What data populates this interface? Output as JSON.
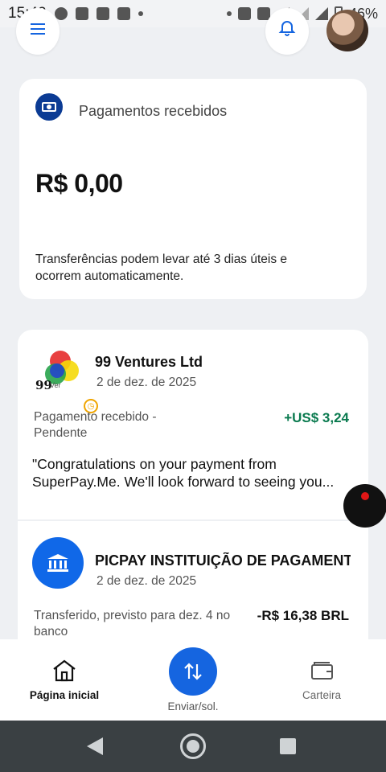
{
  "status_bar": {
    "time": "15:42",
    "battery": "46%"
  },
  "summary_card": {
    "title": "Pagamentos recebidos",
    "amount": "R$ 0,00",
    "note": "Transferências podem levar até 3 dias úteis e ocorrem automaticamente."
  },
  "transactions": [
    {
      "name": "99 Ventures Ltd",
      "date": "2 de dez. de 2025",
      "status": "Pagamento recebido - Pendente",
      "amount": "+US$ 3,24",
      "message_line1": "\"Congratulations on your payment from",
      "message_line2": "SuperPay.Me. We'll look forward to seeing you...",
      "logo_text": "99",
      "logo_sub": "Ver"
    },
    {
      "name": "PICPAY INSTITUIÇÃO DE PAGAMENTOS",
      "date": "2 de dez. de 2025",
      "status": "Transferido, previsto para dez. 4 no banco",
      "amount": "-R$ 16,38 BRL"
    }
  ],
  "bottom_nav": {
    "home": "Página inicial",
    "send": "Enviar/sol.",
    "wallet": "Carteira"
  },
  "colors": {
    "accent": "#1565e0",
    "positive": "#0a7a4f",
    "navy": "#0b3b94"
  }
}
